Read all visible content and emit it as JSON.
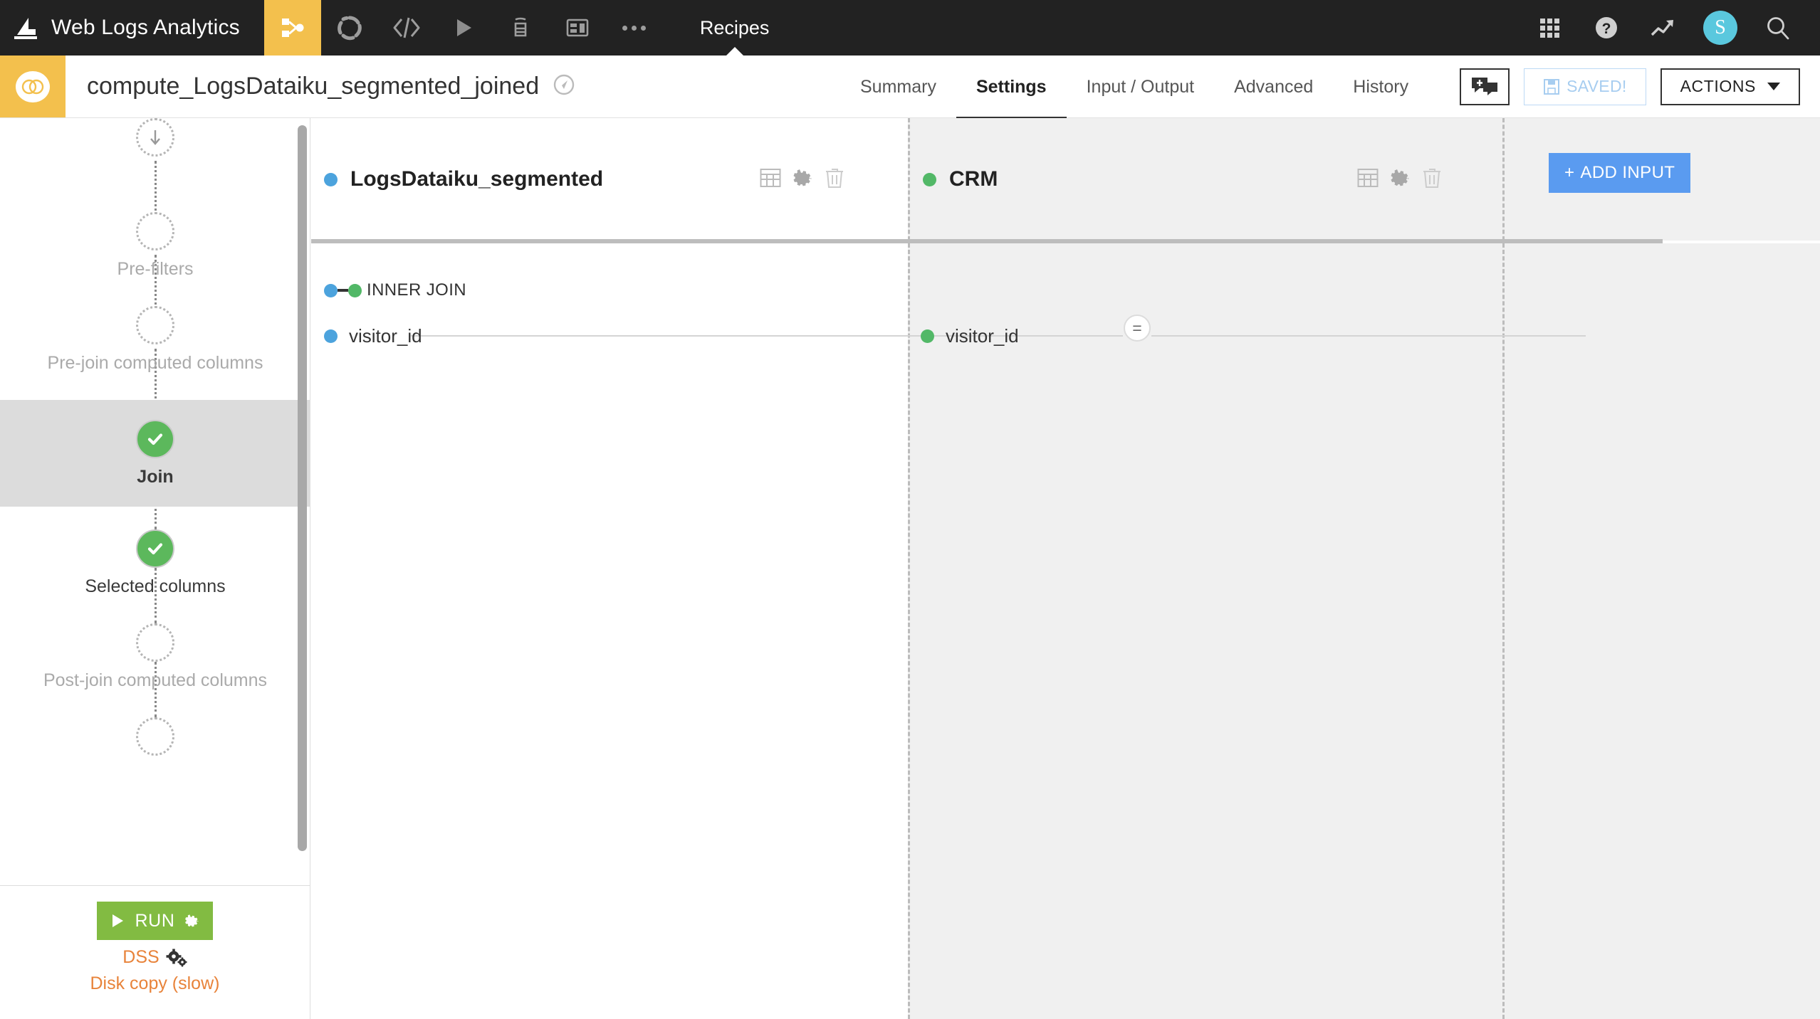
{
  "topnav": {
    "logo_icon": "dataiku-bird-logo",
    "project_name": "Web Logs Analytics",
    "icons": [
      {
        "name": "flow-icon",
        "active": true
      },
      {
        "name": "dashboard-wheel-icon",
        "active": false
      },
      {
        "name": "code-brackets-icon",
        "active": false
      },
      {
        "name": "play-triangle-icon",
        "active": false
      },
      {
        "name": "lab-flask-icon",
        "active": false
      },
      {
        "name": "dashboard-layout-icon",
        "active": false
      }
    ],
    "more_icon": "ellipsis-icon",
    "section_label": "Recipes",
    "right_icons": [
      {
        "name": "apps-grid-icon"
      },
      {
        "name": "help-question-icon"
      },
      {
        "name": "trend-arrow-icon"
      }
    ],
    "avatar_initial": "S",
    "avatar_color": "#5ac8de",
    "search_icon": "search-icon",
    "background": "#222222",
    "accent": "#f3c04d"
  },
  "subheader": {
    "recipe_icon": "join-recipe-icon",
    "recipe_icon_bg": "#f3c04d",
    "recipe_title": "compute_LogsDataiku_segmented_joined",
    "zoom_icon": "flow-locate-icon",
    "tabs": [
      {
        "label": "Summary",
        "active": false
      },
      {
        "label": "Settings",
        "active": true
      },
      {
        "label": "Input / Output",
        "active": false
      },
      {
        "label": "Advanced",
        "active": false
      },
      {
        "label": "History",
        "active": false
      }
    ],
    "chat_icon": "discussions-icon",
    "saved_label": "SAVED!",
    "saved_icon": "floppy-disk-icon",
    "saved_color": "#a7cdf0",
    "actions_label": "ACTIONS"
  },
  "sidebar": {
    "steps": [
      {
        "label": "",
        "state": "pending",
        "icon": "arrow-down-icon",
        "highlight": false
      },
      {
        "label": "Pre-filters",
        "state": "pending",
        "icon": "",
        "highlight": false
      },
      {
        "label": "Pre-join computed columns",
        "state": "pending",
        "icon": "",
        "highlight": false
      },
      {
        "label": "Join",
        "state": "done",
        "icon": "check-icon",
        "highlight": true
      },
      {
        "label": "Selected columns",
        "state": "done",
        "icon": "check-icon",
        "highlight": false
      },
      {
        "label": "Post-join computed columns",
        "state": "pending",
        "icon": "",
        "highlight": false
      },
      {
        "label": "",
        "state": "pending",
        "icon": "",
        "highlight": false
      }
    ],
    "run_label": "RUN",
    "run_gear_icon": "gear-icon",
    "run_play_icon": "play-triangle-icon",
    "run_color": "#82bb42",
    "engine_label": "DSS",
    "engine_icon": "gears-icon",
    "mode_label": "Disk copy (slow)",
    "orange": "#e8833a"
  },
  "main": {
    "inputs": [
      {
        "name": "LogsDataiku_segmented",
        "dot_color": "#4ca3dd",
        "actions": [
          "table-grid-icon",
          "gear-icon",
          "trash-icon"
        ]
      },
      {
        "name": "CRM",
        "dot_color": "#52b867",
        "actions": [
          "table-grid-icon",
          "gear-icon",
          "trash-icon"
        ]
      }
    ],
    "add_input_label": "ADD INPUT",
    "add_input_color": "#5a9bf0",
    "join": {
      "type_label": "INNER JOIN",
      "left_dot_color": "#4ca3dd",
      "right_dot_color": "#52b867",
      "operator": "=",
      "conditions": [
        {
          "left_column": "visitor_id",
          "right_column": "visitor_id"
        }
      ]
    }
  }
}
